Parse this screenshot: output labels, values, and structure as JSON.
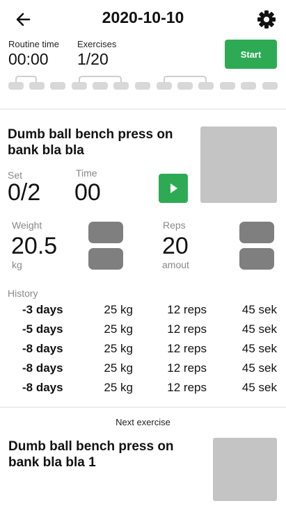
{
  "header": {
    "title": "2020-10-10"
  },
  "stats": {
    "routine_time_label": "Routine time",
    "routine_time_value": "00:00",
    "exercises_label": "Exercises",
    "exercises_value": "1/20"
  },
  "start_label": "Start",
  "current_exercise": {
    "title": "Dumb ball bench press on bank bla bla",
    "set_label": "Set",
    "set_value": "0/2",
    "time_label": "Time",
    "time_value": "00",
    "weight_label": "Weight",
    "weight_value": "20.5",
    "weight_unit": "kg",
    "reps_label": "Reps",
    "reps_value": "20",
    "reps_unit": "amout"
  },
  "history": {
    "label": "History",
    "rows": [
      {
        "day": "-3 days",
        "weight": "25 kg",
        "reps": "12 reps",
        "duration": "45 sek"
      },
      {
        "day": "-5 days",
        "weight": "25 kg",
        "reps": "12 reps",
        "duration": "45 sek"
      },
      {
        "day": "-8 days",
        "weight": "25 kg",
        "reps": "12 reps",
        "duration": "45 sek"
      },
      {
        "day": "-8 days",
        "weight": "25 kg",
        "reps": "12 reps",
        "duration": "45 sek"
      },
      {
        "day": "-8 days",
        "weight": "25 kg",
        "reps": "12 reps",
        "duration": "45 sek"
      }
    ]
  },
  "next_exercise": {
    "label": "Next exercise",
    "title": "Dumb ball bench press on bank bla bla 1"
  },
  "colors": {
    "accent": "#2eaa55",
    "placeholder": "#c4c4c4",
    "stepper": "#7f7f7f",
    "dot": "#d8d8d8"
  },
  "icons": {
    "back": "arrow-left-icon",
    "settings": "gear-icon",
    "play": "play-icon"
  }
}
